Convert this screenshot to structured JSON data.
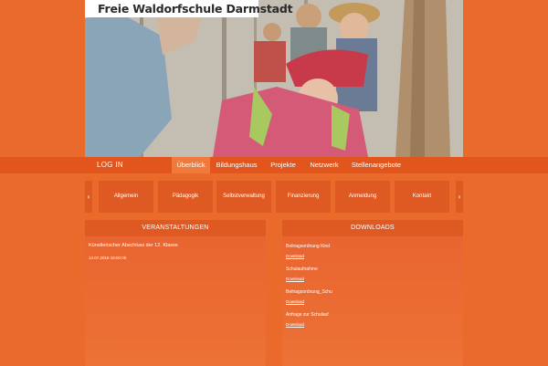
{
  "site": {
    "title": "Freie Waldorfschule Darmstadt"
  },
  "header": {
    "login_label": "LOG IN"
  },
  "main_nav": [
    {
      "label": "Überblick",
      "active": true
    },
    {
      "label": "Bildungshaus",
      "active": false
    },
    {
      "label": "Projekte",
      "active": false
    },
    {
      "label": "Netzwerk",
      "active": false
    },
    {
      "label": "Stellenangebote",
      "active": false
    }
  ],
  "sub_nav": {
    "prev": "‹",
    "next": "›",
    "items": [
      "Allgemein",
      "Pädagogik",
      "Selbstverwaltung",
      "Finanzierung",
      "Anmeldung",
      "Kontakt"
    ]
  },
  "events": {
    "heading": "VERANSTALTUNGEN",
    "items": [
      {
        "title": "Künstlerischer Abschluss der 12. Klasse",
        "date": "14.07.2016 19:00:00"
      }
    ]
  },
  "downloads": {
    "heading": "DOWNLOADS",
    "link_label": "Download",
    "items": [
      "Beitragsordnung Kind",
      "Schulaufnahme",
      "Beitragsordnung_Schu",
      "Anfrage zur Schulauf"
    ]
  },
  "colors": {
    "background": "#ea6a2c",
    "bar": "#e2561e",
    "tile": "#df5a22",
    "active_tab": "#ef7a3c"
  }
}
